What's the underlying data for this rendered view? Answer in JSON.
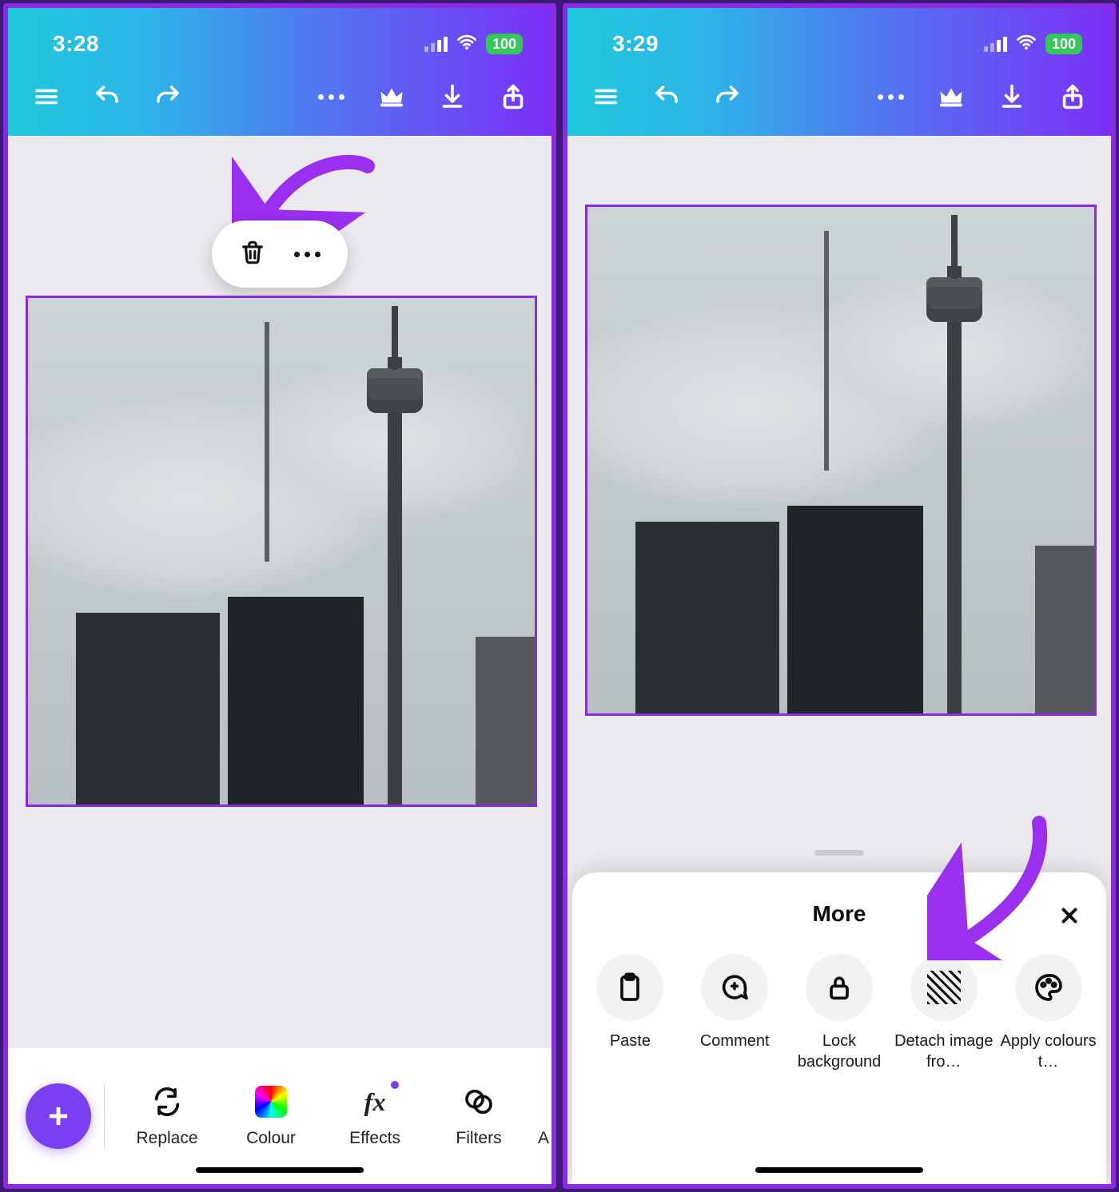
{
  "left": {
    "status": {
      "time": "3:28",
      "battery": "100"
    },
    "toolbar": {
      "replace": "Replace",
      "colour": "Colour",
      "effects": "Effects",
      "filters": "Filters",
      "overflow_initial": "A"
    }
  },
  "right": {
    "status": {
      "time": "3:29",
      "battery": "100"
    },
    "sheet": {
      "title": "More",
      "items": {
        "paste": "Paste",
        "comment": "Comment",
        "lock": "Lock background",
        "detach": "Detach image fro…",
        "apply": "Apply colours t…"
      }
    }
  }
}
